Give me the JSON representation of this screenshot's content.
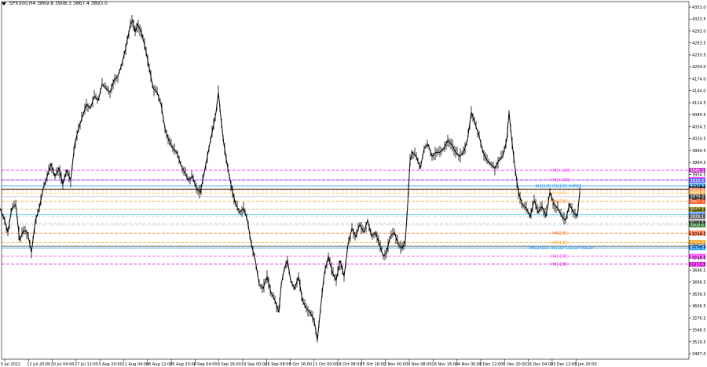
{
  "window": {
    "symbol": "SPX500,H4",
    "ohlc": "3869.8 3908.3 3867.4 3893.0"
  },
  "chart_data": {
    "type": "candlestick",
    "symbol": "SPX500",
    "timeframe": "H4",
    "ylim": [
      3480,
      4365
    ],
    "price_ticks": [
      "4353.0",
      "4323.5",
      "4293.0",
      "4263.5",
      "4233.5",
      "4204.0",
      "4174.0",
      "4144.0",
      "4114.5",
      "4084.5",
      "4054.5",
      "4024.5",
      "3994.5",
      "3964.5",
      "3934.5",
      "3904.5",
      "3874.5",
      "3844.5",
      "3814.5",
      "3784.5",
      "3754.5",
      "3726.5",
      "3696.5",
      "3666.5",
      "3636.5",
      "3606.5",
      "3576.5",
      "3546.5",
      "3516.5",
      "3487.0"
    ],
    "time_ticks": [
      "5 Jul 2022",
      "12 Jul 20:00",
      "20 Jul 04:00",
      "27 Jul 12:00",
      "3 Aug 20:00",
      "11 Aug 04:00",
      "18 Aug 12:00",
      "25 Aug 20:00",
      "2 Sep 04:00",
      "9 Sep 16:00",
      "19 Sep 00:00",
      "26 Sep 08:00",
      "3 Oct 16:00",
      "11 Oct 00:00",
      "18 Oct 08:00",
      "25 Oct 16:00",
      "2 Nov 00:00",
      "9 Nov 08:00",
      "16 Nov 16:00",
      "24 Nov 00:00",
      "1 Dec 12:00",
      "8 Dec 20:00",
      "16 Dec 04:00",
      "23 Dec 12:00",
      "3 Jan 20:00"
    ],
    "price_path": [
      [
        0,
        3850
      ],
      [
        6,
        3820
      ],
      [
        10,
        3790
      ],
      [
        15,
        3850
      ],
      [
        20,
        3860
      ],
      [
        25,
        3770
      ],
      [
        30,
        3795
      ],
      [
        35,
        3790
      ],
      [
        40,
        3740
      ],
      [
        45,
        3820
      ],
      [
        50,
        3850
      ],
      [
        55,
        3900
      ],
      [
        60,
        3930
      ],
      [
        65,
        3960
      ],
      [
        70,
        3930
      ],
      [
        75,
        3950
      ],
      [
        80,
        3910
      ],
      [
        85,
        3945
      ],
      [
        90,
        3920
      ],
      [
        95,
        4010
      ],
      [
        100,
        4050
      ],
      [
        105,
        4080
      ],
      [
        110,
        4110
      ],
      [
        115,
        4100
      ],
      [
        120,
        4130
      ],
      [
        125,
        4120
      ],
      [
        130,
        4160
      ],
      [
        135,
        4150
      ],
      [
        140,
        4140
      ],
      [
        145,
        4170
      ],
      [
        150,
        4180
      ],
      [
        155,
        4210
      ],
      [
        160,
        4250
      ],
      [
        163,
        4280
      ],
      [
        166,
        4310
      ],
      [
        169,
        4320
      ],
      [
        172,
        4290
      ],
      [
        175,
        4310
      ],
      [
        180,
        4290
      ],
      [
        185,
        4250
      ],
      [
        190,
        4200
      ],
      [
        195,
        4150
      ],
      [
        200,
        4140
      ],
      [
        205,
        4110
      ],
      [
        210,
        4050
      ],
      [
        215,
        4020
      ],
      [
        220,
        4000
      ],
      [
        225,
        3990
      ],
      [
        230,
        3960
      ],
      [
        235,
        3940
      ],
      [
        240,
        3920
      ],
      [
        245,
        3930
      ],
      [
        250,
        3900
      ],
      [
        255,
        3890
      ],
      [
        260,
        3940
      ],
      [
        265,
        3990
      ],
      [
        270,
        4040
      ],
      [
        275,
        4090
      ],
      [
        278,
        4140
      ],
      [
        281,
        4080
      ],
      [
        285,
        4010
      ],
      [
        290,
        3950
      ],
      [
        295,
        3900
      ],
      [
        300,
        3860
      ],
      [
        305,
        3840
      ],
      [
        310,
        3850
      ],
      [
        315,
        3820
      ],
      [
        320,
        3760
      ],
      [
        325,
        3720
      ],
      [
        330,
        3660
      ],
      [
        335,
        3650
      ],
      [
        340,
        3680
      ],
      [
        345,
        3640
      ],
      [
        350,
        3620
      ],
      [
        355,
        3590
      ],
      [
        358,
        3660
      ],
      [
        362,
        3700
      ],
      [
        366,
        3720
      ],
      [
        370,
        3670
      ],
      [
        375,
        3650
      ],
      [
        380,
        3680
      ],
      [
        385,
        3620
      ],
      [
        390,
        3600
      ],
      [
        395,
        3590
      ],
      [
        400,
        3570
      ],
      [
        404,
        3520
      ],
      [
        408,
        3600
      ],
      [
        413,
        3690
      ],
      [
        418,
        3730
      ],
      [
        423,
        3690
      ],
      [
        428,
        3670
      ],
      [
        433,
        3720
      ],
      [
        438,
        3680
      ],
      [
        443,
        3760
      ],
      [
        448,
        3800
      ],
      [
        453,
        3780
      ],
      [
        458,
        3810
      ],
      [
        463,
        3790
      ],
      [
        468,
        3820
      ],
      [
        473,
        3780
      ],
      [
        478,
        3790
      ],
      [
        483,
        3760
      ],
      [
        488,
        3730
      ],
      [
        492,
        3740
      ],
      [
        497,
        3780
      ],
      [
        502,
        3790
      ],
      [
        507,
        3760
      ],
      [
        512,
        3750
      ],
      [
        516,
        3770
      ],
      [
        519,
        3860
      ],
      [
        522,
        3970
      ],
      [
        525,
        3990
      ],
      [
        530,
        3980
      ],
      [
        535,
        3950
      ],
      [
        540,
        4000
      ],
      [
        545,
        4010
      ],
      [
        550,
        3980
      ],
      [
        555,
        3990
      ],
      [
        560,
        3990
      ],
      [
        565,
        4000
      ],
      [
        570,
        4020
      ],
      [
        575,
        4010
      ],
      [
        580,
        3990
      ],
      [
        585,
        3980
      ],
      [
        590,
        3990
      ],
      [
        595,
        4020
      ],
      [
        600,
        4090
      ],
      [
        605,
        4060
      ],
      [
        610,
        4030
      ],
      [
        615,
        3990
      ],
      [
        620,
        3970
      ],
      [
        625,
        3960
      ],
      [
        630,
        3950
      ],
      [
        635,
        3970
      ],
      [
        640,
        3980
      ],
      [
        645,
        4020
      ],
      [
        648,
        4090
      ],
      [
        651,
        4030
      ],
      [
        655,
        3960
      ],
      [
        660,
        3890
      ],
      [
        665,
        3860
      ],
      [
        670,
        3850
      ],
      [
        675,
        3830
      ],
      [
        680,
        3870
      ],
      [
        685,
        3840
      ],
      [
        690,
        3855
      ],
      [
        695,
        3830
      ],
      [
        700,
        3890
      ],
      [
        705,
        3860
      ],
      [
        710,
        3850
      ],
      [
        715,
        3830
      ],
      [
        720,
        3820
      ],
      [
        725,
        3860
      ],
      [
        730,
        3840
      ],
      [
        735,
        3830
      ],
      [
        738,
        3890
      ]
    ],
    "levels": [
      {
        "label": "H4[+2/8]",
        "value": "3945.3",
        "price": 3945.3,
        "color": "#ff33ff",
        "style": "dashed",
        "label_bg": "#cc33cc"
      },
      {
        "label": "H4[+1/8]",
        "value": "3921.9",
        "price": 3921.9,
        "color": "#ff33ff",
        "style": "dashed",
        "label_bg": "#ff33ff"
      },
      {
        "label": "",
        "value": "3919.9",
        "price": 3919.9,
        "color": "#9999ff",
        "style": "solid",
        "label_bg": "#6666ff"
      },
      {
        "label": "W1[1/8] D1[1/8] H4RES",
        "value": "3906.3",
        "price": 3906.3,
        "color": "#2196f3",
        "style": "solid",
        "label_bg": "#2196f3"
      },
      {
        "label": "",
        "value": "3898.1",
        "price": 3898.1,
        "color": "#111111",
        "style": "solid",
        "label_bg": "#111111"
      },
      {
        "label": "",
        "value": "3894.8",
        "price": 3894.8,
        "color": "#ffaa88",
        "style": "dashed",
        "label_bg": "#ff8a65"
      },
      {
        "label": "H4[8/8]",
        "value": "3888.3",
        "price": 3888.3,
        "color": "#ffcc66",
        "style": "dashed",
        "label_bg": "#ffb74d"
      },
      {
        "label": "",
        "value": "3879.3",
        "price": 3879.3,
        "color": "#c8c8c8",
        "style": "solid",
        "label_bg": "#4a4a4a"
      },
      {
        "label": "H4[7/8]",
        "value": "3867.3",
        "price": 3867.3,
        "color": "#ff8800",
        "style": "dashed",
        "label_bg": "#ff5722"
      },
      {
        "label": "",
        "value": "3847.7",
        "price": 3847.7,
        "color": "#bdb76b",
        "style": "dashed",
        "label_bg": "#808000"
      },
      {
        "label": "",
        "value": "3834.3",
        "price": 3834.3,
        "color": "#40c4ff",
        "style": "solid",
        "label_bg": "#2979ff"
      },
      {
        "label": "",
        "value": "3829.1",
        "price": 3829.1,
        "color": "#9aa0a6",
        "style": "dotted",
        "label_bg": "#616161"
      },
      {
        "label": "",
        "value": "3813.5",
        "price": 3813.5,
        "color": "#c8c8c8",
        "style": "dashed",
        "label_bg": "#424242"
      },
      {
        "label": "",
        "value": "3808.6",
        "price": 3808.6,
        "color": "#888888",
        "style": "dotted",
        "label_bg": "#2e7d32"
      },
      {
        "label": "H4[2/8]",
        "value": "3788.3",
        "price": 3788.3,
        "color": "#ff6600",
        "style": "dashed",
        "label_bg": "#ff5722"
      },
      {
        "label": "H4[1/8]",
        "value": "3764.8",
        "price": 3764.8,
        "color": "#ff9900",
        "style": "dashed",
        "label_bg": "#ff9800"
      },
      {
        "label": "",
        "value": "3755.3",
        "price": 3755.3,
        "color": "#444444",
        "style": "solid",
        "label_bg": "#ffffff"
      },
      {
        "label": "MN1PIVOT W1SUP D1SUP H4SUP",
        "value": "3751.3",
        "price": 3751.3,
        "color": "#2196f3",
        "style": "solid",
        "label_bg": "#2196f3"
      },
      {
        "label": "H4[-1/8]",
        "value": "3730.5",
        "price": 3730.5,
        "color": "#ff33ff",
        "style": "dashed",
        "label_bg": "#ff33ff"
      },
      {
        "label": "H4[-2/8]",
        "value": "3710.6",
        "price": 3710.6,
        "color": "#cc00cc",
        "style": "dashed",
        "label_bg": "#cc00cc"
      }
    ],
    "grid": false,
    "legend": "none",
    "colors": {
      "candle": "#000000",
      "axis": "#000000",
      "background": "#ffffff"
    }
  }
}
